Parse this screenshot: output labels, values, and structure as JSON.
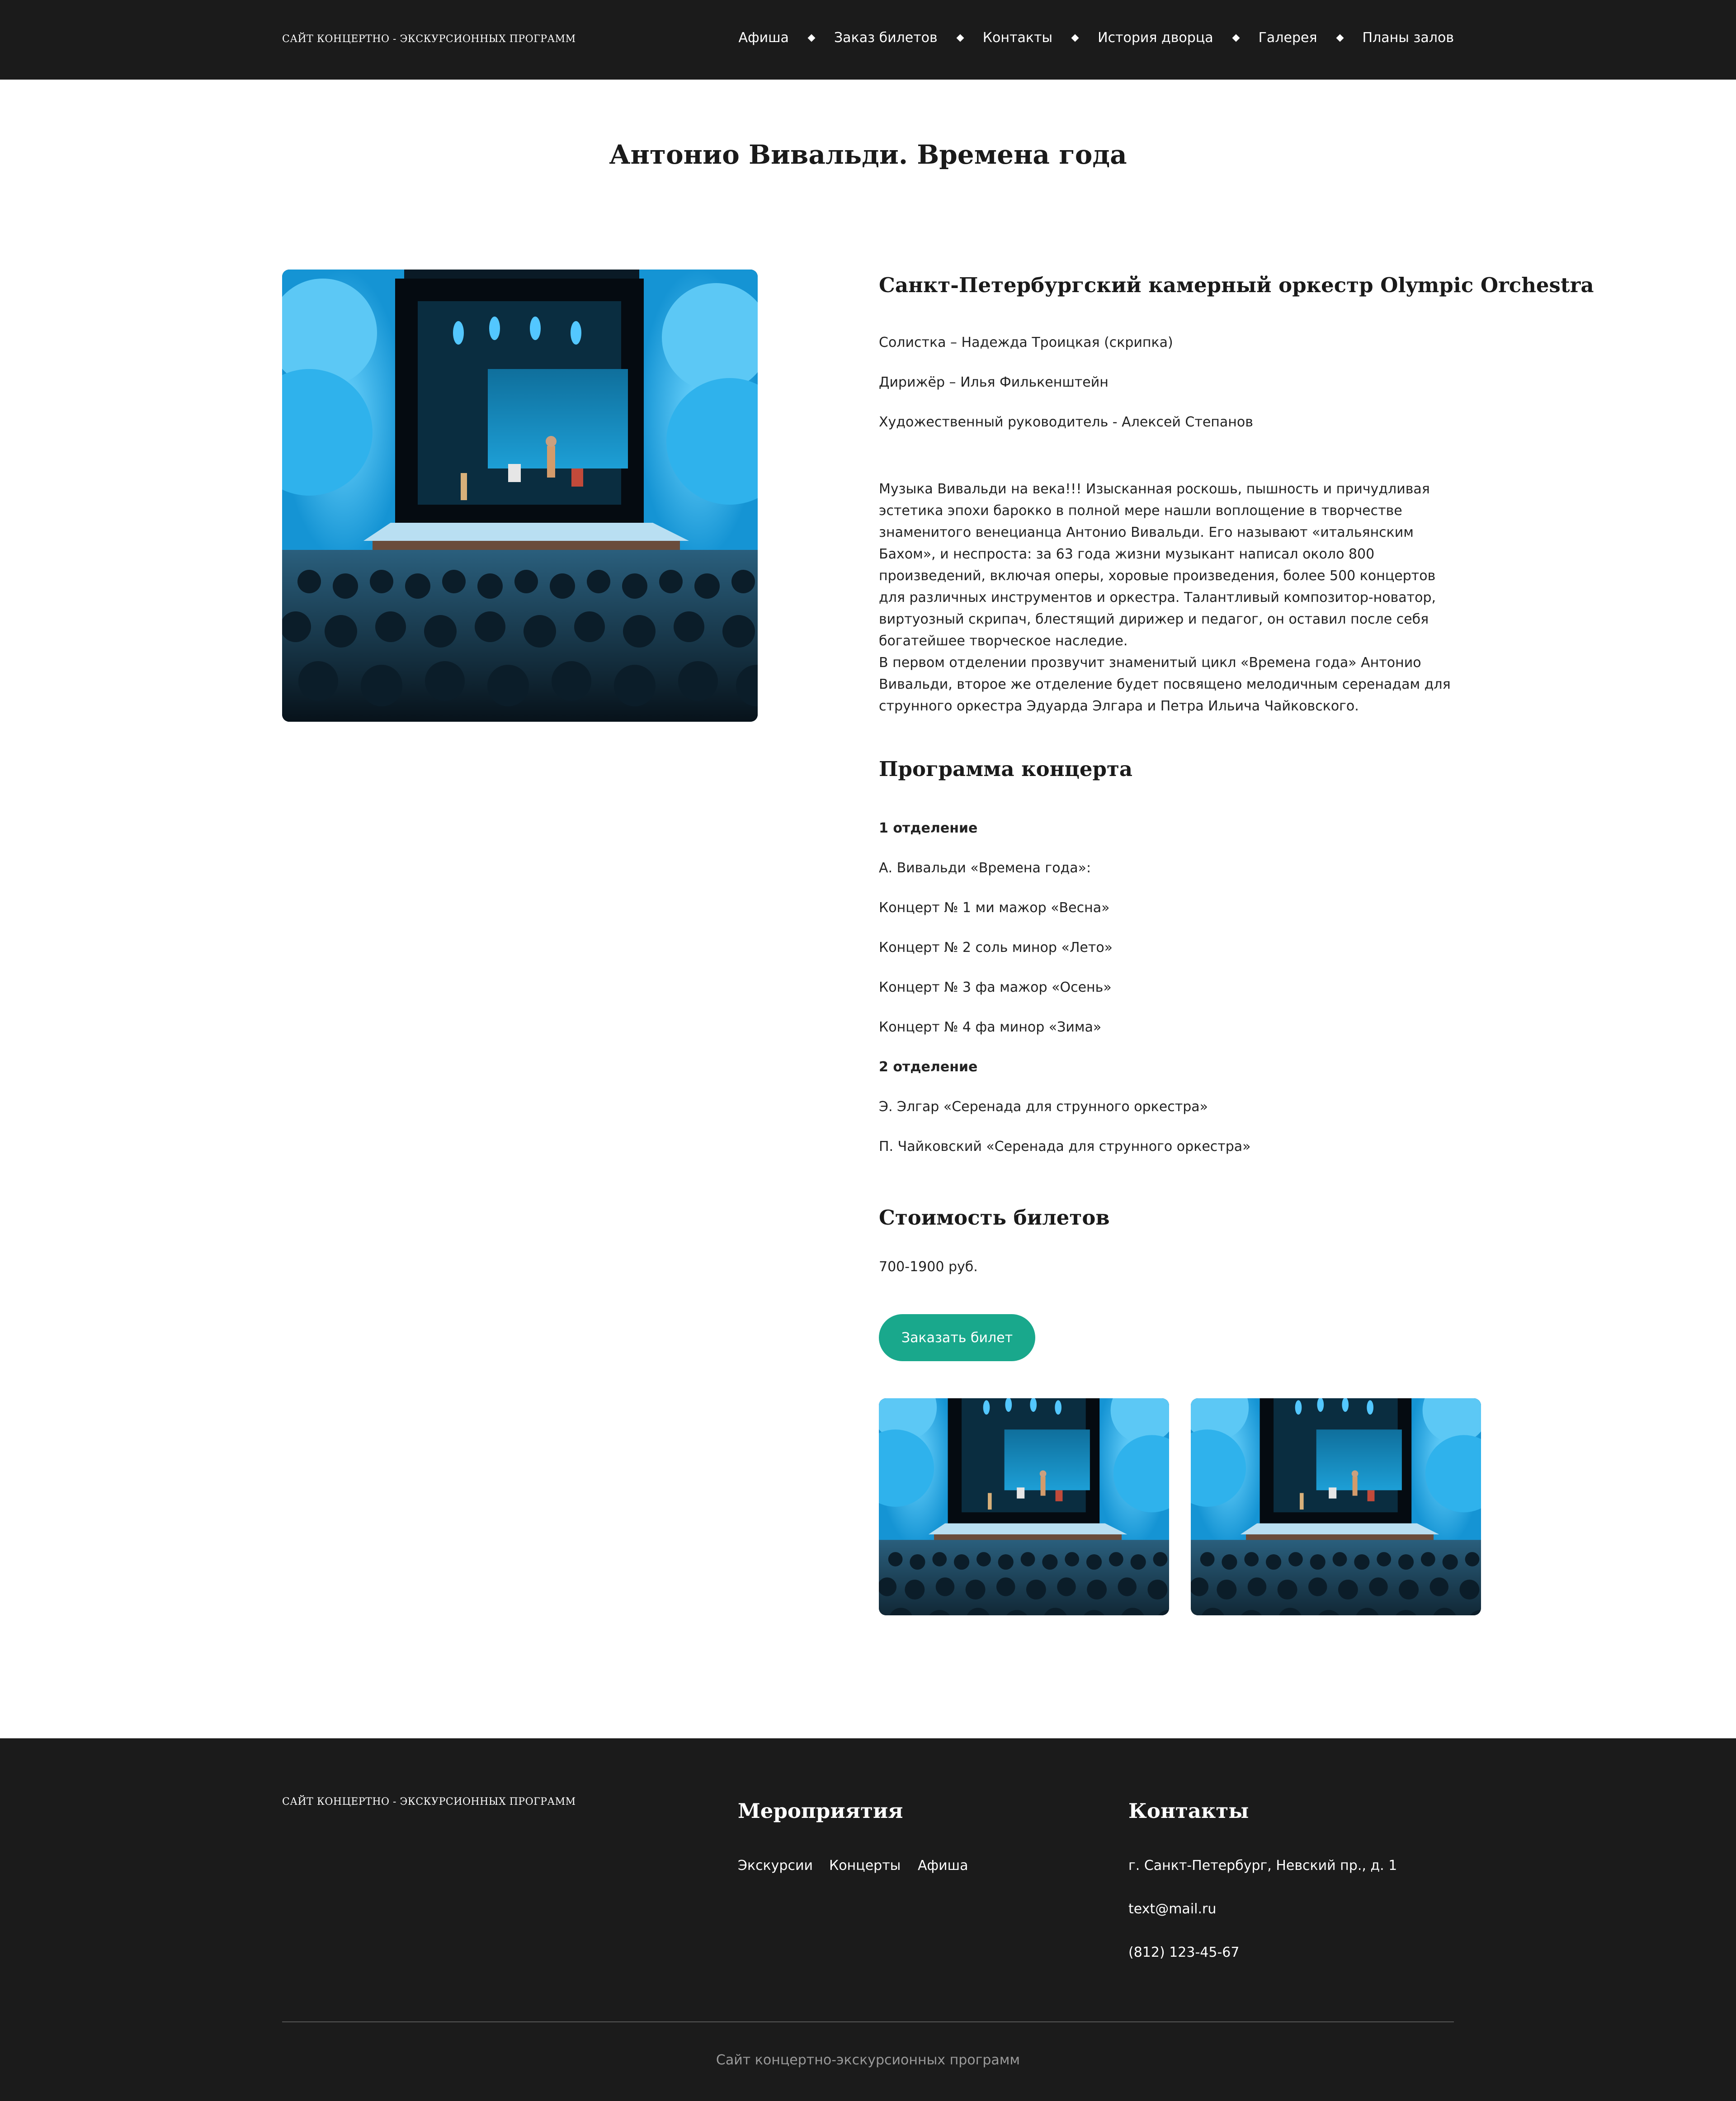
{
  "header": {
    "brand": "САЙТ КОНЦЕРТНО - ЭКСКУРСИОННЫХ ПРОГРАММ",
    "nav": [
      "Афиша",
      "Заказ билетов",
      "Контакты",
      "История дворца",
      "Галерея",
      "Планы залов"
    ]
  },
  "page_title": "Антонио Вивальди. Времена года",
  "event": {
    "orchestra": "Санкт-Петербургский камерный оркестр Olympic Orchestra",
    "soloist": "Солистка – Надежда Троицкая (скрипка)",
    "conductor": "Дирижёр – Илья Филькенштейн",
    "director": "Художественный руководитель - Алексей Степанов",
    "description_1": "Музыка Вивальди на века!!! Изысканная роскошь, пышность и причудливая эстетика эпохи барокко в полной мере нашли воплощение в творчестве знаменитого венецианца Антонио Вивальди. Его называют «итальянским Бахом», и неспроста: за 63 года жизни музыкант написал около 800 произведений, включая оперы, хоровые произведения, более 500 концертов для различных инструментов и оркестра. Талантливый композитор-новатор, виртуозный скрипач, блестящий дирижер и педагог, он оставил после себя богатейшее творческое наследие.",
    "description_2": "В первом отделении прозвучит знаменитый цикл «Времена года» Антонио Вивальди, второе же отделение будет посвящено мелодичным серенадам для струнного оркестра Эдуарда Элгара и Петра Ильича Чайковского."
  },
  "program": {
    "title": "Программа концерта",
    "part1_title": "1 отделение",
    "part1_items": [
      "А. Вивальди «Времена года»:",
      "Концерт № 1 ми мажор «Весна»",
      "Концерт № 2 соль минор «Лето»",
      "Концерт № 3 фа мажор «Осень»",
      "Концерт № 4 фа минор «Зима»"
    ],
    "part2_title": "2 отделение",
    "part2_items": [
      "Э. Элгар «Серенада для струнного оркестра»",
      "П. Чайковский «Серенада для струнного оркестра»"
    ]
  },
  "tickets": {
    "title": "Стоимость билетов",
    "price": "700-1900 руб.",
    "button_label": "Заказать билет"
  },
  "footer": {
    "brand": "САЙТ КОНЦЕРТНО - ЭКСКУРСИОННЫХ ПРОГРАММ",
    "events_title": "Мероприятия",
    "events_links": [
      "Экскурсии",
      "Концерты",
      "Афиша"
    ],
    "contacts_title": "Контакты",
    "address": "г. Санкт-Петербург, Невский пр., д. 1",
    "email": "text@mail.ru",
    "phone": "(812) 123-45-67",
    "copyright": "Сайт концертно-экскурсионных программ"
  },
  "colors": {
    "header_bg": "#1b1b1b",
    "accent": "#19a88c",
    "stage_blue": "#1fb0ee"
  }
}
